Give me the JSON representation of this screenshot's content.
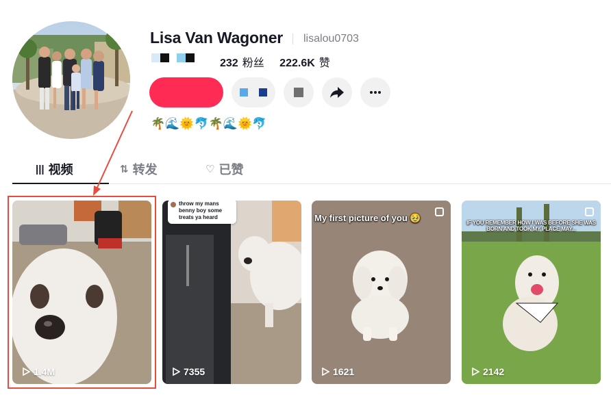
{
  "profile": {
    "name": "Lisa Van Wagoner",
    "handle": "lisalou0703",
    "followers_count": "232",
    "followers_label": "粉丝",
    "likes_count": "222.6K",
    "likes_label": "赞",
    "bio": "🌴🌊🌞🐬🌴🌊🌞🐬"
  },
  "tabs": [
    {
      "icon": "|||",
      "label": "视频",
      "active": true
    },
    {
      "icon": "⇅",
      "label": "转发",
      "active": false
    },
    {
      "icon": "♡",
      "label": "已赞",
      "active": false
    }
  ],
  "videos": [
    {
      "views": "1.4M",
      "caption": "",
      "highlighted": true
    },
    {
      "views": "7355",
      "caption": "throw my mans benny boy some treats ya heard"
    },
    {
      "views": "1621",
      "caption": "My first picture of you 🥹"
    },
    {
      "views": "2142",
      "caption": "IF YOU REMEMBER HOW I WAS BEFORE SHE WAS BORN AND TOOK MY PLACE MAY..."
    }
  ],
  "colors": {
    "accent": "#fe2c55",
    "annotation": "#e74c3c",
    "text": "#161823",
    "muted": "#7b7d85"
  }
}
